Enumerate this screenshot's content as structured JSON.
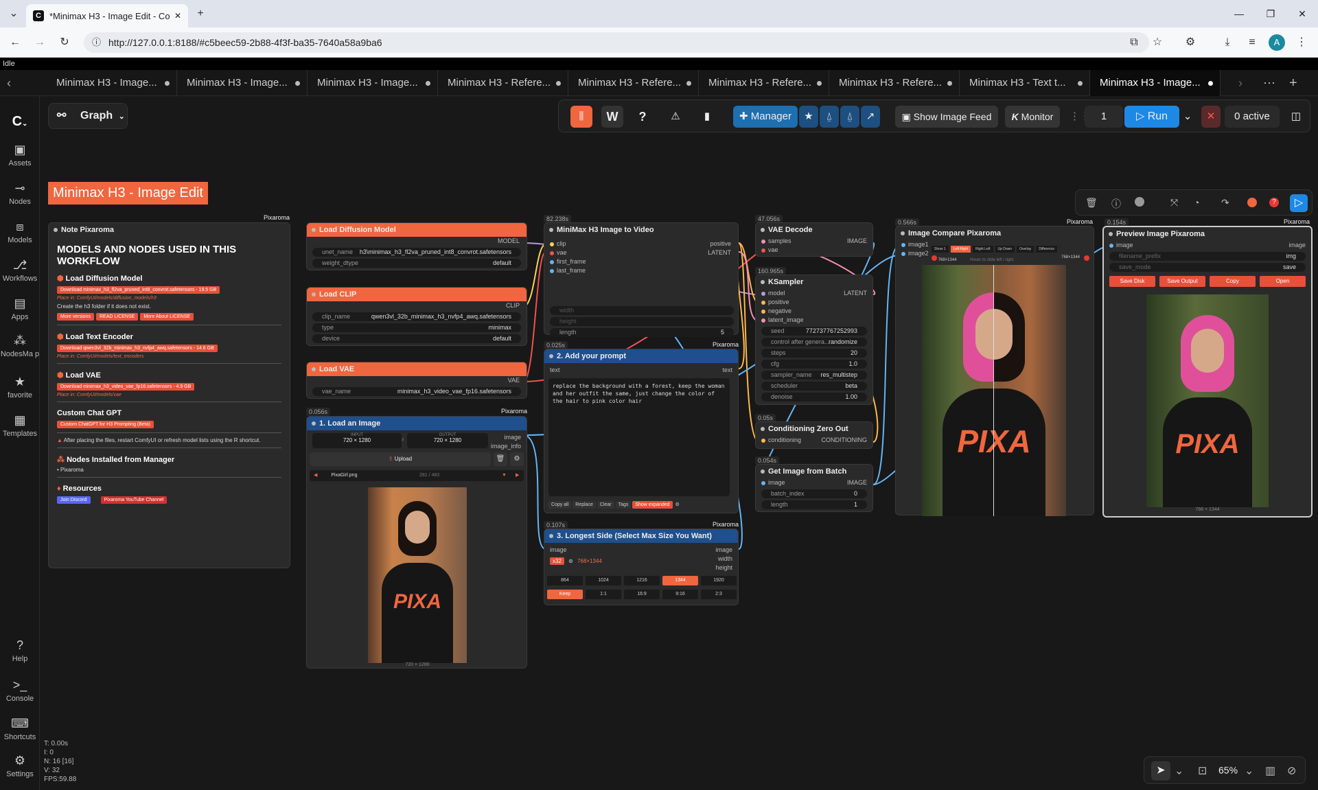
{
  "browser": {
    "tab_title": "*Minimax H3 - Image Edit - Co",
    "url": "http://127.0.0.1:8188/#c5beec59-2b88-4f3f-ba35-7640a58a9ba6",
    "status": "Idle",
    "profile_initial": "A"
  },
  "workflow_tabs": [
    "Minimax H3 - Image...",
    "Minimax H3 - Image...",
    "Minimax H3 - Image...",
    "Minimax H3 - Refere...",
    "Minimax H3 - Refere...",
    "Minimax H3 - Refere...",
    "Minimax H3 - Refere...",
    "Minimax H3 - Text t...",
    "Minimax H3 - Image..."
  ],
  "sidebar": {
    "assets": "Assets",
    "nodes": "Nodes",
    "models": "Models",
    "workflows": "Workflows",
    "apps": "Apps",
    "nodesmap": "NodesMa p",
    "favorite": "favorite",
    "templates": "Templates",
    "help": "Help",
    "console": "Console",
    "shortcuts": "Shortcuts",
    "settings": "Settings"
  },
  "canvas": {
    "graph_label": "Graph",
    "workflow_title": "Minimax H3 - Image Edit"
  },
  "toolbar": {
    "manager": "Manager",
    "show_image_feed": "Show Image Feed",
    "monitor": "Monitor",
    "queue_count": "1",
    "run": "Run",
    "active": "0 active"
  },
  "note_node": {
    "title": "Note Pixaroma",
    "heading": "MODELS AND NODES USED IN THIS WORKFLOW",
    "s1": "Load Diffusion Model",
    "s1_btn": "Download minimax_h3_fl2va_pruned_int8_convrot.safetensors - 19.5 GB",
    "s1_path": "Place in: ComfyUI/models/diffusion_models/h3",
    "s1_note": "Create the  h3  folder if it does not exist.",
    "s1_btns": [
      "More versions",
      "READ LICENSE",
      "More About LICENSE"
    ],
    "s2": "Load Text Encoder",
    "s2_btn": "Download qwen3vl_32b_minimax_h3_nvfp4_awq.safetensors - 14.6 GB",
    "s2_path": "Place in: ComfyUI/models/text_encoders",
    "s3": "Load VAE",
    "s3_btn": "Download minimax_h3_video_vae_fp16.safetensors - 4.9 GB",
    "s3_path": "Place in: ComfyUI/models/vae",
    "s4": "Custom Chat GPT",
    "s4_btn": "Custom ChatGPT for H3 Prompting (Beta)",
    "warn": "After placing the files, restart ComfyUI or refresh model lists using the R shortcut.",
    "s5": "Nodes Installed from Manager",
    "s5_item": "Pixaroma",
    "s6": "Resources",
    "discord": "Join Discord",
    "youtube": "Pixaroma YouTube Channel",
    "pix": "Pixaroma"
  },
  "load_diffusion": {
    "title": "Load Diffusion Model",
    "out": "MODEL",
    "unet_label": "unet_name",
    "unet_value": "h3\\minimax_h3_fl2va_pruned_int8_convrot.safetensors",
    "dtype_label": "weight_dtype",
    "dtype_value": "default"
  },
  "load_clip": {
    "title": "Load CLIP",
    "out": "CLIP",
    "clip_label": "clip_name",
    "clip_value": "qwen3vl_32b_minimax_h3_nvfp4_awq.safetensors",
    "type_label": "type",
    "type_value": "minimax",
    "device_label": "device",
    "device_value": "default"
  },
  "load_vae": {
    "title": "Load VAE",
    "out": "VAE",
    "vae_label": "vae_name",
    "vae_value": "minimax_h3_video_vae_fp16.safetensors"
  },
  "load_image": {
    "timer": "0.056s",
    "pix": "Pixaroma",
    "title": "1. Load an Image",
    "input_label": "INPUT",
    "input_val": "720 × 1280",
    "output_label": "OUTPUT",
    "output_val": "720 × 1280",
    "out1": "image",
    "out2": "image_info",
    "upload": "Upload",
    "file": "PixaGirl.png",
    "file_idx": "281 / 483",
    "dims": "720 × 1280"
  },
  "i2v": {
    "timer": "82.238s",
    "title": "MiniMax H3 Image to Video",
    "in": [
      "clip",
      "vae",
      "first_frame",
      "last_frame"
    ],
    "out1": "positive",
    "out2": "LATENT",
    "w_width": "width",
    "w_height": "height",
    "length_label": "length",
    "length_value": "5"
  },
  "prompt": {
    "timer": "0.025s",
    "pix": "Pixaroma",
    "title": "2. Add your prompt",
    "in": "text",
    "out": "text",
    "text": "replace the background with a forest, keep the woman and her outfit the same, just change the color of the hair to pink color hair",
    "btns": [
      "Copy all",
      "Replace",
      "Clear",
      "Tags",
      "Show expanded"
    ]
  },
  "longest": {
    "timer": "0.107s",
    "pix": "Pixaroma",
    "title": "3. Longest Side (Select Max Size You Want)",
    "in": "image",
    "outs": [
      "image",
      "width",
      "height"
    ],
    "scale": "x32",
    "dims": "768×1344",
    "sizes": [
      "864",
      "1024",
      "1216",
      "1344",
      "1920"
    ],
    "ratios": [
      "Keep",
      "1:1",
      "16:9",
      "9:16",
      "2:3"
    ]
  },
  "vae_decode": {
    "timer": "47.056s",
    "title": "VAE Decode",
    "in1": "samples",
    "in2": "vae",
    "out": "IMAGE"
  },
  "ksampler": {
    "timer": "160.965s",
    "title": "KSampler",
    "ins": [
      "model",
      "positive",
      "negative",
      "latent_image"
    ],
    "out": "LATENT",
    "w": [
      [
        "seed",
        "772737767252993"
      ],
      [
        "control after genera...",
        "randomize"
      ],
      [
        "steps",
        "20"
      ],
      [
        "cfg",
        "1.0"
      ],
      [
        "sampler_name",
        "res_multistep"
      ],
      [
        "scheduler",
        "beta"
      ],
      [
        "denoise",
        "1.00"
      ]
    ]
  },
  "czo": {
    "timer": "0.05s",
    "title": "Conditioning Zero Out",
    "in": "conditioning",
    "out": "CONDITIONING"
  },
  "gib": {
    "timer": "0.054s",
    "title": "Get Image from Batch",
    "in": "image",
    "out": "IMAGE",
    "w": [
      [
        "batch_index",
        "0"
      ],
      [
        "length",
        "1"
      ]
    ]
  },
  "compare": {
    "timer": "0.566s",
    "pix": "Pixaroma",
    "title": "Image Compare Pixaroma",
    "in1": "image1",
    "in2": "image2",
    "modes": [
      "Show 1",
      "Left Right",
      "Right Left",
      "Up Down",
      "Overlay",
      "Difference"
    ],
    "left_dims": "768×1344",
    "right_dims": "768×1344",
    "hint": "Hover to slide left / right"
  },
  "preview": {
    "timer": "0.154s",
    "pix": "Pixaroma",
    "title": "Preview Image Pixaroma",
    "in": "image",
    "out": "image",
    "prefix_label": "filename_prefix",
    "prefix_value": "img",
    "save_label": "save_mode",
    "save_value": "save",
    "btns": [
      "Save Disk",
      "Save Output",
      "Copy",
      "Open"
    ],
    "dims": "768 × 1344"
  },
  "shirt_text": "PIXA",
  "zoom": "65%",
  "stats": [
    "T: 0.00s",
    "I: 0",
    "N: 16 [16]",
    "V: 32",
    "FPS:59.88"
  ]
}
